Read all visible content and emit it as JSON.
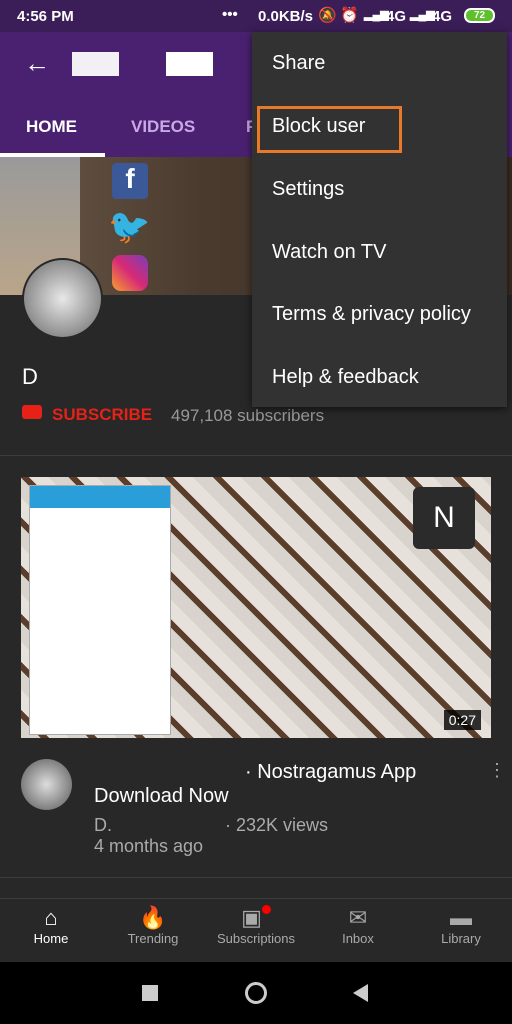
{
  "status": {
    "time": "4:56 PM",
    "dots": "•••",
    "speed": "0.0KB/s",
    "net1": "4G",
    "net2": "4G",
    "battery": "72"
  },
  "header": {
    "back_icon": "arrow-left-icon"
  },
  "tabs": [
    {
      "label": "HOME",
      "active": true
    },
    {
      "label": "VIDEOS"
    },
    {
      "label": "P"
    }
  ],
  "channel": {
    "name": "D",
    "subscribe_label": "SUBSCRIBE",
    "subscribers": "497,108 subscribers"
  },
  "menu": {
    "items": [
      "Share",
      "Block user",
      "Settings",
      "Watch on TV",
      "Terms & privacy policy",
      "Help & feedback"
    ],
    "highlighted": "Block user",
    "highlight_color": "#e8792b"
  },
  "video": {
    "duration": "0:27",
    "title_line1": "· Nostragamus App",
    "title_line2": "Download Now",
    "channel_initial": "D.",
    "views": "· 232K views",
    "age": "4 months ago"
  },
  "bottom_nav": [
    {
      "label": "Home",
      "icon": "home-icon",
      "active": true
    },
    {
      "label": "Trending",
      "icon": "flame-icon"
    },
    {
      "label": "Subscriptions",
      "icon": "subscriptions-icon",
      "badge": true
    },
    {
      "label": "Inbox",
      "icon": "mail-icon"
    },
    {
      "label": "Library",
      "icon": "folder-icon"
    }
  ]
}
